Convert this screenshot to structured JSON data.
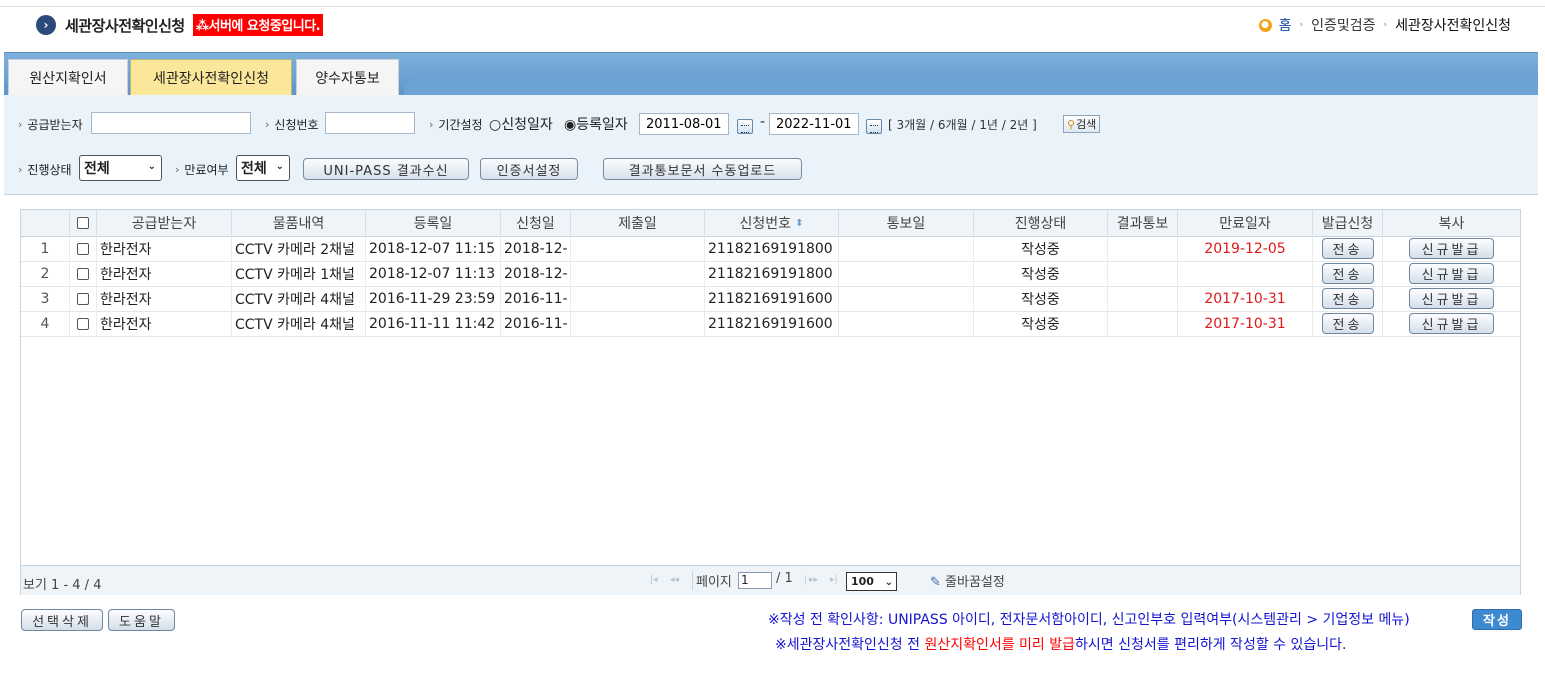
{
  "header": {
    "title": "세관장사전확인신청",
    "loading_text": "서버에 요청중입니다.",
    "breadcrumb": {
      "home": "홈",
      "level1": "인증및검증",
      "current": "세관장사전확인신청"
    }
  },
  "tabs": [
    {
      "label": "원산지확인서",
      "active": false
    },
    {
      "label": "세관장사전확인신청",
      "active": true
    },
    {
      "label": "양수자통보",
      "active": false
    }
  ],
  "filters": {
    "supplier_label": "공급받는자",
    "supplier_value": "",
    "appno_label": "신청번호",
    "appno_value": "",
    "period_label": "기간설정",
    "radio_apply": "○신청일자",
    "radio_reg": "◉등록일자",
    "date_from": "2011-08-01",
    "date_sep": "-",
    "date_to": "2022-11-01",
    "period_presets": "[ 3개월 / 6개월 / 1년 / 2년 ]",
    "search_label": "검색",
    "status_label": "진행상태",
    "status_value": "전체",
    "expiry_label": "만료여부",
    "expiry_value": "전체",
    "btn_unipass": "UNI-PASS 결과수신",
    "btn_cert": "인증서설정",
    "btn_upload": "결과통보문서 수동업로드"
  },
  "grid": {
    "columns": [
      "공급받는자",
      "물품내역",
      "등록일",
      "신청일",
      "제출일",
      "신청번호",
      "통보일",
      "진행상태",
      "결과통보",
      "만료일자",
      "발급신청",
      "복사"
    ],
    "send_label": "전송",
    "copy_label": "신규발급",
    "rows": [
      {
        "no": "1",
        "supplier": "한라전자",
        "item": "CCTV 카메라 2채널",
        "reg": "2018-12-07 11:15",
        "apply": "2018-12-",
        "submit": "",
        "appno": "21182169191800",
        "notice": "",
        "status": "작성중",
        "result": "",
        "expiry": "2019-12-05"
      },
      {
        "no": "2",
        "supplier": "한라전자",
        "item": "CCTV 카메라 1채널",
        "reg": "2018-12-07 11:13",
        "apply": "2018-12-",
        "submit": "",
        "appno": "21182169191800",
        "notice": "",
        "status": "작성중",
        "result": "",
        "expiry": ""
      },
      {
        "no": "3",
        "supplier": "한라전자",
        "item": "CCTV 카메라 4채널",
        "reg": "2016-11-29 23:59",
        "apply": "2016-11-",
        "submit": "",
        "appno": "21182169191600",
        "notice": "",
        "status": "작성중",
        "result": "",
        "expiry": "2017-10-31"
      },
      {
        "no": "4",
        "supplier": "한라전자",
        "item": "CCTV 카메라 4채널",
        "reg": "2016-11-11 11:42",
        "apply": "2016-11-",
        "submit": "",
        "appno": "21182169191600",
        "notice": "",
        "status": "작성중",
        "result": "",
        "expiry": "2017-10-31"
      }
    ],
    "footer": {
      "view_text": "보기 1 - 4 / 4",
      "page_label": "페이지",
      "page_value": "1",
      "page_total": "/ 1",
      "page_size": "100",
      "wrap_setting": "줄바꿈설정"
    }
  },
  "bottom": {
    "btn_delete": "선택삭제",
    "btn_help": "도움말",
    "notice1": "※작성 전 확인사항: UNIPASS 아이디, 전자문서함아이디, 신고인부호 입력여부(시스템관리 > 기업정보 메뉴)",
    "notice2_a": "※세관장사전확인신청 전 ",
    "notice2_b": "원산지확인서를 미리 발급",
    "notice2_c": "하시면 신청서를 편리하게 작성할 수 있습니다.",
    "btn_write": "작성"
  },
  "colors": {
    "accent": "#5d95cb",
    "active_tab": "#fbe79a",
    "loading": "#ff0000",
    "expiry": "#e01818",
    "notice": "#1414d2"
  }
}
